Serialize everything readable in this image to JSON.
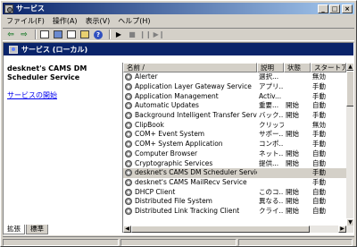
{
  "window": {
    "title": "サービス",
    "controls": {
      "minimize": "_",
      "maximize": "□",
      "close": "×"
    }
  },
  "menu": [
    {
      "label": "ファイル(F)"
    },
    {
      "label": "操作(A)"
    },
    {
      "label": "表示(V)"
    },
    {
      "label": "ヘルプ(H)"
    }
  ],
  "toolbar": {
    "back": "⇦",
    "forward": "⇨",
    "start": "▶",
    "stop": "■",
    "pause": "❙❙",
    "restart": "▶❙",
    "help": "?"
  },
  "scope": {
    "title": "サービス (ローカル)"
  },
  "description": {
    "service_name": "desknet's CAMS DM Scheduler Service",
    "start_link": "サービスの開始"
  },
  "list": {
    "columns": [
      {
        "label": "名前 /"
      },
      {
        "label": "説明"
      },
      {
        "label": "状態"
      },
      {
        "label": "スタートアップ"
      }
    ],
    "rows": [
      {
        "name": "Alerter",
        "desc": "選択...",
        "status": "",
        "startup": "無効"
      },
      {
        "name": "Application Layer Gateway Service",
        "desc": "アプリ...",
        "status": "",
        "startup": "手動"
      },
      {
        "name": "Application Management",
        "desc": "Activ...",
        "status": "",
        "startup": "手動"
      },
      {
        "name": "Automatic Updates",
        "desc": "重要...",
        "status": "開始",
        "startup": "自動"
      },
      {
        "name": "Background Intelligent Transfer Service",
        "desc": "バック...",
        "status": "開始",
        "startup": "手動"
      },
      {
        "name": "ClipBook",
        "desc": "クリップ...",
        "status": "",
        "startup": "無効"
      },
      {
        "name": "COM+ Event System",
        "desc": "サポー...",
        "status": "開始",
        "startup": "手動"
      },
      {
        "name": "COM+ System Application",
        "desc": "コンポ...",
        "status": "",
        "startup": "手動"
      },
      {
        "name": "Computer Browser",
        "desc": "ネット...",
        "status": "開始",
        "startup": "自動"
      },
      {
        "name": "Cryptographic Services",
        "desc": "提供...",
        "status": "開始",
        "startup": "自動"
      },
      {
        "name": "desknet's CAMS DM Scheduler Service",
        "desc": "",
        "status": "",
        "startup": "手動"
      },
      {
        "name": "desknet's CAMS MailRecv Service",
        "desc": "",
        "status": "",
        "startup": "手動"
      },
      {
        "name": "DHCP Client",
        "desc": "このコ...",
        "status": "開始",
        "startup": "自動"
      },
      {
        "name": "Distributed File System",
        "desc": "異なる...",
        "status": "開始",
        "startup": "自動"
      },
      {
        "name": "Distributed Link Tracking Client",
        "desc": "クライ...",
        "status": "開始",
        "startup": "自動"
      }
    ],
    "selected_index": 10
  },
  "tabs": [
    {
      "label": "拡張",
      "active": true
    },
    {
      "label": "標準",
      "active": false
    }
  ]
}
